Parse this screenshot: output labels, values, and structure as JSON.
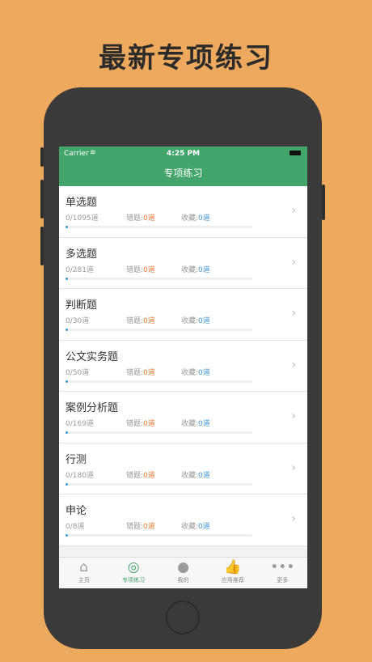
{
  "promo": {
    "title": "最新专项练习"
  },
  "status_bar": {
    "carrier": "Carrier",
    "time": "4:25 PM"
  },
  "nav": {
    "title": "专项练习"
  },
  "labels": {
    "wrong": "错题:",
    "favorites": "收藏:"
  },
  "rows": [
    {
      "title": "单选题",
      "total": "0/1095道",
      "wrong": "0道",
      "fav": "0道",
      "progress": 0
    },
    {
      "title": "多选题",
      "total": "0/281道",
      "wrong": "0道",
      "fav": "0道",
      "progress": 0
    },
    {
      "title": "判断题",
      "total": "0/30道",
      "wrong": "0道",
      "fav": "0道",
      "progress": 0
    },
    {
      "title": "公文实务题",
      "total": "0/50道",
      "wrong": "0道",
      "fav": "0道",
      "progress": 0
    },
    {
      "title": "案例分析题",
      "total": "0/169道",
      "wrong": "0道",
      "fav": "0道",
      "progress": 0
    },
    {
      "title": "行测",
      "total": "0/180道",
      "wrong": "0道",
      "fav": "0道",
      "progress": 0
    },
    {
      "title": "申论",
      "total": "0/8道",
      "wrong": "0道",
      "fav": "0道",
      "progress": 0
    }
  ],
  "tabs": [
    {
      "label": "主页",
      "icon": "home-icon",
      "active": false
    },
    {
      "label": "专项练习",
      "icon": "target-icon",
      "active": true
    },
    {
      "label": "我的",
      "icon": "person-icon",
      "active": false
    },
    {
      "label": "应用推荐",
      "icon": "thumbs-up-icon",
      "active": false
    },
    {
      "label": "更多",
      "icon": "more-icon",
      "active": false
    }
  ],
  "colors": {
    "background": "#EDA95E",
    "accent_green": "#43A56B",
    "wrong_orange": "#E8782F",
    "fav_blue": "#3E97D8"
  }
}
